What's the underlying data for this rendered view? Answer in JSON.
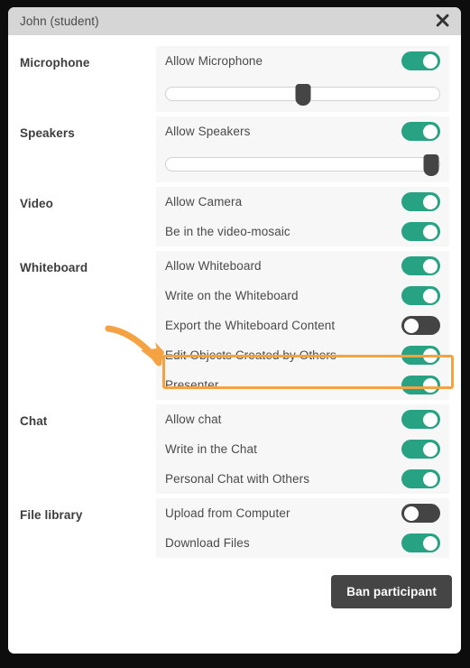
{
  "window": {
    "title": "John (student)",
    "close_icon": "close-icon"
  },
  "colors": {
    "toggle_on": "#27a383",
    "toggle_off": "#444444",
    "highlight": "#f5a243",
    "titlebar": "#d6d6d6",
    "panel": "#f7f7f7",
    "button": "#454545"
  },
  "sections": [
    {
      "label": "Microphone",
      "rows": [
        {
          "label": "Allow Microphone",
          "state": "on"
        }
      ],
      "slider": {
        "name": "microphone-volume-slider",
        "value": 50
      }
    },
    {
      "label": "Speakers",
      "rows": [
        {
          "label": "Allow Speakers",
          "state": "on"
        }
      ],
      "slider": {
        "name": "speakers-volume-slider",
        "value": 97
      }
    },
    {
      "label": "Video",
      "rows": [
        {
          "label": "Allow Camera",
          "state": "on"
        },
        {
          "label": "Be in the video-mosaic",
          "state": "on"
        }
      ],
      "slider": null
    },
    {
      "label": "Whiteboard",
      "rows": [
        {
          "label": "Allow Whiteboard",
          "state": "on"
        },
        {
          "label": "Write on the Whiteboard",
          "state": "on"
        },
        {
          "label": "Export the Whiteboard Content",
          "state": "off"
        },
        {
          "label": "Edit Objects Created by Others",
          "state": "on"
        },
        {
          "label": "Presenter",
          "state": "on"
        }
      ],
      "slider": null
    },
    {
      "label": "Chat",
      "rows": [
        {
          "label": "Allow chat",
          "state": "on"
        },
        {
          "label": "Write in the Chat",
          "state": "on"
        },
        {
          "label": "Personal Chat with Others",
          "state": "on"
        }
      ],
      "slider": null
    },
    {
      "label": "File library",
      "rows": [
        {
          "label": "Upload from Computer",
          "state": "off"
        },
        {
          "label": "Download Files",
          "state": "on"
        }
      ],
      "slider": null
    }
  ],
  "footer": {
    "ban_label": "Ban participant"
  },
  "annotations": {
    "highlight_target": "Presenter",
    "arrow": "curved-arrow-icon"
  }
}
